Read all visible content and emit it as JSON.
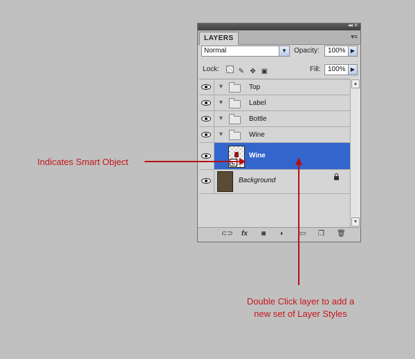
{
  "panel": {
    "tab_label": "LAYERS",
    "blend_mode": "Normal",
    "opacity_label": "Opacity:",
    "opacity_value": "100%",
    "lock_label": "Lock:",
    "fill_label": "Fill:",
    "fill_value": "100%"
  },
  "layers": [
    {
      "name": "Top",
      "type": "group"
    },
    {
      "name": "Label",
      "type": "group"
    },
    {
      "name": "Bottle",
      "type": "group"
    },
    {
      "name": "Wine",
      "type": "group"
    },
    {
      "name": "Wine",
      "type": "smart-object",
      "selected": true
    },
    {
      "name": "Background",
      "type": "background",
      "locked": true
    }
  ],
  "annotations": {
    "smart_object": "Indicates Smart Object",
    "double_click_line1": "Double Click layer to add a",
    "double_click_line2": "new set of Layer Styles"
  },
  "colors": {
    "background": "#c0c0c0",
    "selection": "#3366cc",
    "annotation": "#c4161c"
  }
}
